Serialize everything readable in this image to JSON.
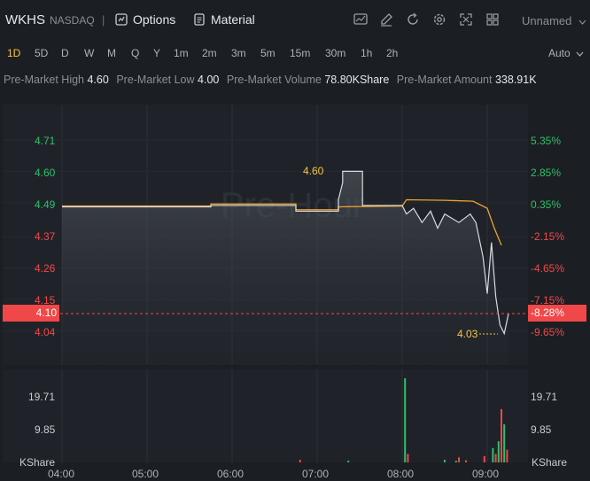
{
  "header": {
    "ticker": "WKHS",
    "exchange": "NASDAQ",
    "separator": "|",
    "options_label": "Options",
    "material_label": "Material",
    "layout_name": "Unnamed",
    "icons": [
      "chart-type-icon",
      "draw-icon",
      "refresh-icon",
      "settings-icon",
      "fullscreen-icon",
      "layout-grid-icon"
    ]
  },
  "periods": [
    "1D",
    "5D",
    "D",
    "W",
    "M",
    "Q",
    "Y",
    "1m",
    "2m",
    "3m",
    "5m",
    "15m",
    "30m",
    "1h",
    "2h"
  ],
  "active_period": "1D",
  "scale_mode": "Auto",
  "stats": [
    {
      "label": "Pre-Market High",
      "value": "4.60"
    },
    {
      "label": "Pre-Market Low",
      "value": "4.00"
    },
    {
      "label": "Pre-Market Volume",
      "value": "78.80KShare"
    },
    {
      "label": "Pre-Market Amount",
      "value": "338.91K"
    }
  ],
  "watermark": "Pre-Hour",
  "colors": {
    "up": "#2fbf6a",
    "down": "#f04848",
    "price_line": "#d8dadf",
    "avg_line": "#f0a02a",
    "highlight": "#f6c445"
  },
  "chart_data": {
    "type": "line",
    "price_axis_left": [
      "4.71",
      "4.60",
      "4.49",
      "4.37",
      "4.26",
      "4.15",
      "4.04"
    ],
    "pct_axis_right": [
      "5.35%",
      "2.85%",
      "0.35%",
      "-2.15%",
      "-4.65%",
      "-7.15%",
      "-9.65%"
    ],
    "current_price": "4.10",
    "current_pct": "-8.28%",
    "high_marker": "4.60",
    "low_marker": "4.03",
    "volume_axis": [
      "19.71",
      "9.85"
    ],
    "volume_unit": "KShare",
    "x_ticks": [
      "04:00",
      "05:00",
      "06:00",
      "07:00",
      "08:00",
      "09:00"
    ],
    "ylim": [
      3.98,
      4.75
    ],
    "price_series": [
      {
        "t": "04:00",
        "v": 4.475
      },
      {
        "t": "05:45",
        "v": 4.475
      },
      {
        "t": "05:45",
        "v": 4.48
      },
      {
        "t": "06:45",
        "v": 4.48
      },
      {
        "t": "06:45",
        "v": 4.46
      },
      {
        "t": "07:15",
        "v": 4.46
      },
      {
        "t": "07:15",
        "v": 4.5
      },
      {
        "t": "07:18",
        "v": 4.56
      },
      {
        "t": "07:18",
        "v": 4.6
      },
      {
        "t": "07:32",
        "v": 4.6
      },
      {
        "t": "07:32",
        "v": 4.48
      },
      {
        "t": "08:00",
        "v": 4.48
      },
      {
        "t": "08:03",
        "v": 4.45
      },
      {
        "t": "08:08",
        "v": 4.47
      },
      {
        "t": "08:14",
        "v": 4.42
      },
      {
        "t": "08:20",
        "v": 4.46
      },
      {
        "t": "08:25",
        "v": 4.4
      },
      {
        "t": "08:30",
        "v": 4.45
      },
      {
        "t": "08:40",
        "v": 4.42
      },
      {
        "t": "08:48",
        "v": 4.45
      },
      {
        "t": "08:52",
        "v": 4.42
      },
      {
        "t": "08:57",
        "v": 4.3
      },
      {
        "t": "09:00",
        "v": 4.17
      },
      {
        "t": "09:03",
        "v": 4.35
      },
      {
        "t": "09:06",
        "v": 4.16
      },
      {
        "t": "09:09",
        "v": 4.06
      },
      {
        "t": "09:12",
        "v": 4.03
      },
      {
        "t": "09:15",
        "v": 4.1
      }
    ],
    "avg_series": [
      {
        "t": "04:00",
        "v": 4.478
      },
      {
        "t": "05:45",
        "v": 4.478
      },
      {
        "t": "05:45",
        "v": 4.485
      },
      {
        "t": "06:45",
        "v": 4.485
      },
      {
        "t": "06:45",
        "v": 4.465
      },
      {
        "t": "07:15",
        "v": 4.465
      },
      {
        "t": "07:15",
        "v": 4.475
      },
      {
        "t": "08:00",
        "v": 4.478
      },
      {
        "t": "08:03",
        "v": 4.5
      },
      {
        "t": "08:30",
        "v": 4.498
      },
      {
        "t": "08:50",
        "v": 4.495
      },
      {
        "t": "09:00",
        "v": 4.47
      },
      {
        "t": "09:05",
        "v": 4.4
      },
      {
        "t": "09:10",
        "v": 4.34
      }
    ],
    "volume_series": [
      {
        "t": "06:48",
        "v": 0.6,
        "dir": "down"
      },
      {
        "t": "07:22",
        "v": 0.4,
        "dir": "up"
      },
      {
        "t": "08:02",
        "v": 19.9,
        "dir": "up"
      },
      {
        "t": "08:04",
        "v": 2.0,
        "dir": "down"
      },
      {
        "t": "08:30",
        "v": 0.6,
        "dir": "up"
      },
      {
        "t": "08:38",
        "v": 0.4,
        "dir": "up"
      },
      {
        "t": "08:40",
        "v": 1.2,
        "dir": "down"
      },
      {
        "t": "08:45",
        "v": 0.5,
        "dir": "down"
      },
      {
        "t": "08:58",
        "v": 1.5,
        "dir": "down"
      },
      {
        "t": "09:04",
        "v": 3.4,
        "dir": "up"
      },
      {
        "t": "09:06",
        "v": 2.0,
        "dir": "down"
      },
      {
        "t": "09:08",
        "v": 5.0,
        "dir": "up"
      },
      {
        "t": "09:10",
        "v": 12.6,
        "dir": "down"
      },
      {
        "t": "09:12",
        "v": 9.0,
        "dir": "up"
      },
      {
        "t": "09:14",
        "v": 3.0,
        "dir": "down"
      }
    ]
  }
}
